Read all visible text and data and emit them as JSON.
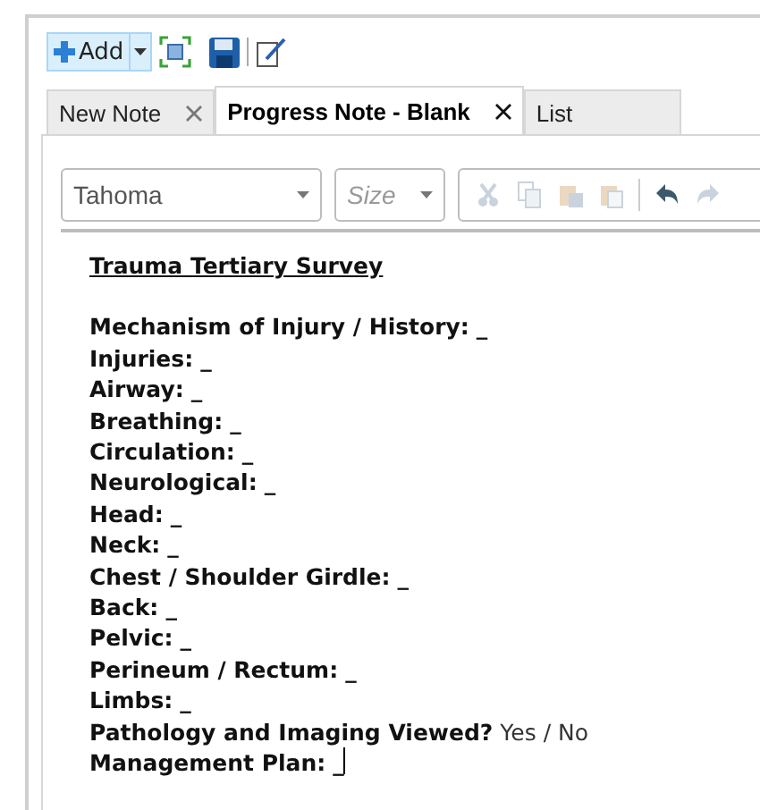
{
  "toolbar": {
    "add_button": "Add"
  },
  "tabs": [
    {
      "label": "New Note",
      "selected": false,
      "closable": true
    },
    {
      "label": "Progress Note - Blank",
      "selected": true,
      "closable": true
    },
    {
      "label": "List",
      "selected": false,
      "closable": false
    }
  ],
  "editor_toolbar": {
    "font": "Tahoma",
    "size_placeholder": "Size",
    "tools": [
      {
        "kind": "cut",
        "disabled": true
      },
      {
        "kind": "copy",
        "disabled": true
      },
      {
        "kind": "paste",
        "disabled": true
      },
      {
        "kind": "paste-special",
        "disabled": true
      },
      {
        "kind": "separator",
        "disabled": true
      },
      {
        "kind": "undo",
        "disabled": false
      },
      {
        "kind": "redo",
        "disabled": true
      }
    ]
  },
  "document": {
    "title": "Trauma Tertiary Survey",
    "lines": [
      {
        "label": "Mechanism of Injury / History:",
        "answer": "_",
        "answer_bold": true,
        "caret": false
      },
      {
        "label": "Injuries:",
        "answer": "_",
        "answer_bold": true,
        "caret": false
      },
      {
        "label": "Airway:",
        "answer": "_",
        "answer_bold": true,
        "caret": false
      },
      {
        "label": "Breathing:",
        "answer": "_",
        "answer_bold": true,
        "caret": false
      },
      {
        "label": "Circulation:",
        "answer": "_",
        "answer_bold": true,
        "caret": false
      },
      {
        "label": "Neurological:",
        "answer": "_",
        "answer_bold": true,
        "caret": false
      },
      {
        "label": "Head:",
        "answer": "_",
        "answer_bold": true,
        "caret": false
      },
      {
        "label": "Neck:",
        "answer": "_",
        "answer_bold": true,
        "caret": false
      },
      {
        "label": "Chest / Shoulder Girdle:",
        "answer": "_",
        "answer_bold": true,
        "caret": false
      },
      {
        "label": "Back:",
        "answer": "_",
        "answer_bold": true,
        "caret": false
      },
      {
        "label": "Pelvic:",
        "answer": "_",
        "answer_bold": true,
        "caret": false
      },
      {
        "label": "Perineum / Rectum:",
        "answer": "_",
        "answer_bold": true,
        "caret": false
      },
      {
        "label": "Limbs:",
        "answer": "_",
        "answer_bold": true,
        "caret": false
      },
      {
        "label": "Pathology and Imaging Viewed?",
        "answer": "Yes / No",
        "answer_bold": false,
        "caret": false
      },
      {
        "label": "Management Plan:",
        "answer": "_",
        "answer_bold": true,
        "caret": true
      }
    ]
  }
}
